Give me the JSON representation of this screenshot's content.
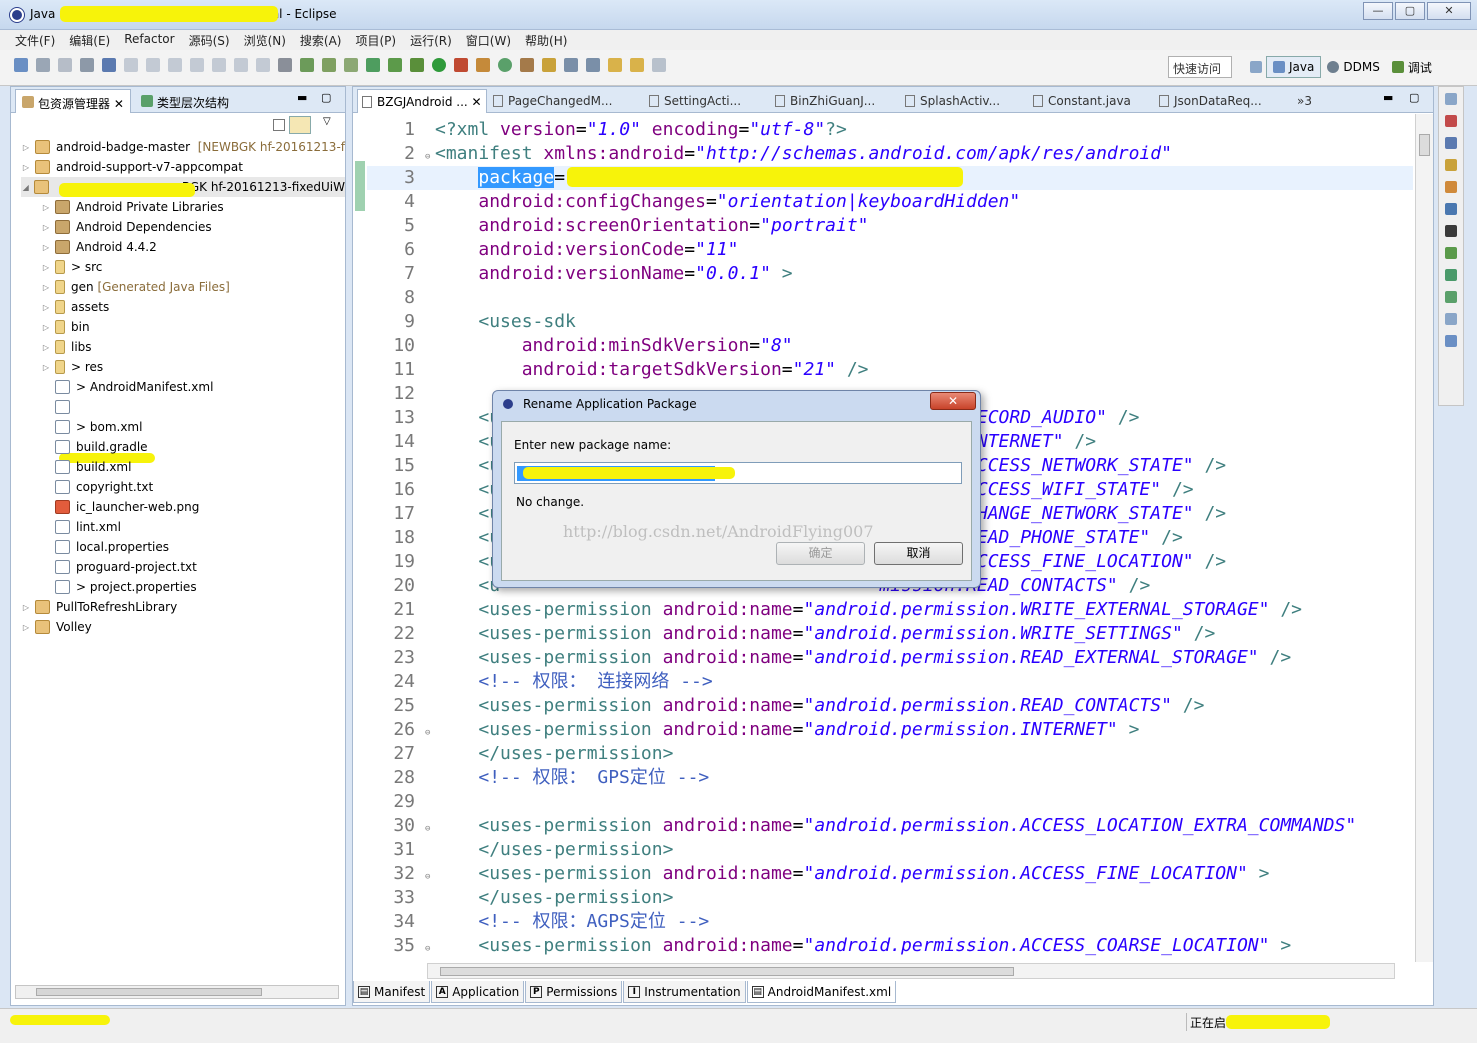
{
  "window": {
    "title": "Java - [ ] Manifest.xml - Eclipse",
    "title_visible_left": "Java",
    "title_visible_right": "Manifest.xml - Eclipse",
    "min": "—",
    "max": "▢",
    "close": "✕"
  },
  "menu": [
    "文件(F)",
    "编辑(E)",
    "Refactor",
    "源码(S)",
    "浏览(N)",
    "搜索(A)",
    "项目(P)",
    "运行(R)",
    "窗口(W)",
    "帮助(H)"
  ],
  "toolbar": {
    "quick_access": "快速访问",
    "perspectives": [
      "Java",
      "DDMS",
      "调试"
    ]
  },
  "left_panel": {
    "tabs": [
      {
        "label": "包资源管理器 ✕"
      },
      {
        "label": "类型层次结构"
      }
    ],
    "tree": [
      {
        "label": "android-badge-master",
        "decoration": "[NEWBGK hf-20161213-f",
        "indent": 0
      },
      {
        "label": "android-support-v7-appcompat",
        "decoration": "",
        "indent": 0
      },
      {
        "label": "BGK hf-20161213-fixedUiW",
        "decoration": "",
        "indent": 0
      },
      {
        "label": "Android Private Libraries",
        "decoration": "",
        "indent": 1
      },
      {
        "label": "Android Dependencies",
        "decoration": "",
        "indent": 1
      },
      {
        "label": "Android 4.4.2",
        "decoration": "",
        "indent": 1
      },
      {
        "label": "> src",
        "decoration": "",
        "indent": 1
      },
      {
        "label": "gen",
        "decoration": "[Generated Java Files]",
        "indent": 1
      },
      {
        "label": "assets",
        "decoration": "",
        "indent": 1
      },
      {
        "label": "bin",
        "decoration": "",
        "indent": 1
      },
      {
        "label": "libs",
        "decoration": "",
        "indent": 1
      },
      {
        "label": "> res",
        "decoration": "",
        "indent": 1
      },
      {
        "label": "> AndroidManifest.xml",
        "decoration": "",
        "indent": 1
      },
      {
        "label": "",
        "decoration": "",
        "indent": 1
      },
      {
        "label": "> bom.xml",
        "decoration": "",
        "indent": 1
      },
      {
        "label": "build.gradle",
        "decoration": "",
        "indent": 1
      },
      {
        "label": "build.xml",
        "decoration": "",
        "indent": 1
      },
      {
        "label": "copyright.txt",
        "decoration": "",
        "indent": 1
      },
      {
        "label": "ic_launcher-web.png",
        "decoration": "",
        "indent": 1
      },
      {
        "label": "lint.xml",
        "decoration": "",
        "indent": 1
      },
      {
        "label": "local.properties",
        "decoration": "",
        "indent": 1
      },
      {
        "label": "proguard-project.txt",
        "decoration": "",
        "indent": 1
      },
      {
        "label": "> project.properties",
        "decoration": "",
        "indent": 1
      },
      {
        "label": "PullToRefreshLibrary",
        "decoration": "",
        "indent": 0
      },
      {
        "label": "Volley",
        "decoration": "",
        "indent": 0
      }
    ]
  },
  "editor": {
    "tabs": [
      "BZGJAndroid ...",
      "PageChangedM...",
      "SettingActi...",
      "BinZhiGuanJ...",
      "SplashActiv...",
      "Constant.java",
      "JsonDataReq...",
      "»3"
    ],
    "lines": [
      {
        "n": "1",
        "fold": "",
        "cur": false,
        "parts": [
          [
            "ct",
            "<?xml "
          ],
          [
            "ca",
            "version"
          ],
          [
            "cn",
            "="
          ],
          [
            "cv",
            "\"1.0\""
          ],
          [
            "ca",
            " encoding"
          ],
          [
            "cn",
            "="
          ],
          [
            "cv",
            "\"utf-8\""
          ],
          [
            "ct",
            "?>"
          ]
        ]
      },
      {
        "n": "2",
        "fold": "⊖",
        "cur": false,
        "parts": [
          [
            "ct",
            "<manifest "
          ],
          [
            "ca",
            "xmlns:android"
          ],
          [
            "cn",
            "="
          ],
          [
            "cv",
            "\"http://schemas.android.com/apk/res/android\""
          ]
        ]
      },
      {
        "n": "3",
        "fold": "",
        "cur": true,
        "parts": [
          [
            "cn",
            "    "
          ],
          [
            "sel",
            "package"
          ],
          [
            "cn",
            "="
          ],
          [
            "cv",
            "\"                              \""
          ]
        ]
      },
      {
        "n": "4",
        "fold": "",
        "cur": false,
        "parts": [
          [
            "cn",
            "    "
          ],
          [
            "ca",
            "android:configChanges"
          ],
          [
            "cn",
            "="
          ],
          [
            "cv",
            "\"orientation|keyboardHidden\""
          ]
        ]
      },
      {
        "n": "5",
        "fold": "",
        "cur": false,
        "parts": [
          [
            "cn",
            "    "
          ],
          [
            "ca",
            "android:screenOrientation"
          ],
          [
            "cn",
            "="
          ],
          [
            "cv",
            "\"portrait\""
          ]
        ]
      },
      {
        "n": "6",
        "fold": "",
        "cur": false,
        "parts": [
          [
            "cn",
            "    "
          ],
          [
            "ca",
            "android:versionCode"
          ],
          [
            "cn",
            "="
          ],
          [
            "cv",
            "\"11\""
          ]
        ]
      },
      {
        "n": "7",
        "fold": "",
        "cur": false,
        "parts": [
          [
            "cn",
            "    "
          ],
          [
            "ca",
            "android:versionName"
          ],
          [
            "cn",
            "="
          ],
          [
            "cv",
            "\"0.0.1\""
          ],
          [
            "ct",
            " >"
          ]
        ]
      },
      {
        "n": "8",
        "fold": "",
        "cur": false,
        "parts": []
      },
      {
        "n": "9",
        "fold": "",
        "cur": false,
        "parts": [
          [
            "cn",
            "    "
          ],
          [
            "ct",
            "<uses-sdk"
          ]
        ]
      },
      {
        "n": "10",
        "fold": "",
        "cur": false,
        "parts": [
          [
            "cn",
            "        "
          ],
          [
            "ca",
            "android:minSdkVersion"
          ],
          [
            "cn",
            "="
          ],
          [
            "cv",
            "\"8\""
          ]
        ]
      },
      {
        "n": "11",
        "fold": "",
        "cur": false,
        "parts": [
          [
            "cn",
            "        "
          ],
          [
            "ca",
            "android:targetSdkVersion"
          ],
          [
            "cn",
            "="
          ],
          [
            "cv",
            "\"21\""
          ],
          [
            "ct",
            " />"
          ]
        ]
      },
      {
        "n": "12",
        "fold": "",
        "cur": false,
        "parts": []
      },
      {
        "n": "13",
        "fold": "",
        "cur": false,
        "parts": [
          [
            "cn",
            "    "
          ],
          [
            "ct",
            "<u"
          ],
          [
            "cn",
            "                                   "
          ],
          [
            "cv",
            "mission.RECORD_AUDIO\""
          ],
          [
            "ct",
            " />"
          ]
        ]
      },
      {
        "n": "14",
        "fold": "",
        "cur": false,
        "parts": [
          [
            "cn",
            "    "
          ],
          [
            "ct",
            "<u"
          ],
          [
            "cn",
            "                                   "
          ],
          [
            "cv",
            "mission.INTERNET\""
          ],
          [
            "ct",
            " />"
          ]
        ]
      },
      {
        "n": "15",
        "fold": "",
        "cur": false,
        "parts": [
          [
            "cn",
            "    "
          ],
          [
            "ct",
            "<u"
          ],
          [
            "cn",
            "                                   "
          ],
          [
            "cv",
            "mission.ACCESS_NETWORK_STATE\""
          ],
          [
            "ct",
            " />"
          ]
        ]
      },
      {
        "n": "16",
        "fold": "",
        "cur": false,
        "parts": [
          [
            "cn",
            "    "
          ],
          [
            "ct",
            "<u"
          ],
          [
            "cn",
            "                                   "
          ],
          [
            "cv",
            "mission.ACCESS_WIFI_STATE\""
          ],
          [
            "ct",
            " />"
          ]
        ]
      },
      {
        "n": "17",
        "fold": "",
        "cur": false,
        "parts": [
          [
            "cn",
            "    "
          ],
          [
            "ct",
            "<u"
          ],
          [
            "cn",
            "                                   "
          ],
          [
            "cv",
            "mission.CHANGE_NETWORK_STATE\""
          ],
          [
            "ct",
            " />"
          ]
        ]
      },
      {
        "n": "18",
        "fold": "",
        "cur": false,
        "parts": [
          [
            "cn",
            "    "
          ],
          [
            "ct",
            "<u"
          ],
          [
            "cn",
            "                                   "
          ],
          [
            "cv",
            "mission.READ_PHONE_STATE\""
          ],
          [
            "ct",
            " />"
          ]
        ]
      },
      {
        "n": "19",
        "fold": "",
        "cur": false,
        "parts": [
          [
            "cn",
            "    "
          ],
          [
            "ct",
            "<u"
          ],
          [
            "cn",
            "                                   "
          ],
          [
            "cv",
            "mission.ACCESS_FINE_LOCATION\""
          ],
          [
            "ct",
            " />"
          ]
        ]
      },
      {
        "n": "20",
        "fold": "",
        "cur": false,
        "parts": [
          [
            "cn",
            "    "
          ],
          [
            "ct",
            "<u"
          ],
          [
            "cn",
            "                                   "
          ],
          [
            "cv",
            "mission.READ_CONTACTS\""
          ],
          [
            "ct",
            " />"
          ]
        ]
      },
      {
        "n": "21",
        "fold": "",
        "cur": false,
        "parts": [
          [
            "cn",
            "    "
          ],
          [
            "ct",
            "<uses-permission "
          ],
          [
            "ca",
            "android:name"
          ],
          [
            "cn",
            "="
          ],
          [
            "cv",
            "\"android.permission.WRITE_EXTERNAL_STORAGE\""
          ],
          [
            "ct",
            " />"
          ]
        ]
      },
      {
        "n": "22",
        "fold": "",
        "cur": false,
        "parts": [
          [
            "cn",
            "    "
          ],
          [
            "ct",
            "<uses-permission "
          ],
          [
            "ca",
            "android:name"
          ],
          [
            "cn",
            "="
          ],
          [
            "cv",
            "\"android.permission.WRITE_SETTINGS\""
          ],
          [
            "ct",
            " />"
          ]
        ]
      },
      {
        "n": "23",
        "fold": "",
        "cur": false,
        "parts": [
          [
            "cn",
            "    "
          ],
          [
            "ct",
            "<uses-permission "
          ],
          [
            "ca",
            "android:name"
          ],
          [
            "cn",
            "="
          ],
          [
            "cv",
            "\"android.permission.READ_EXTERNAL_STORAGE\""
          ],
          [
            "ct",
            " />"
          ]
        ]
      },
      {
        "n": "24",
        "fold": "",
        "cur": false,
        "parts": [
          [
            "cn",
            "    "
          ],
          [
            "cc",
            "<!-- 权限： 连接网络 -->"
          ]
        ]
      },
      {
        "n": "25",
        "fold": "",
        "cur": false,
        "parts": [
          [
            "cn",
            "    "
          ],
          [
            "ct",
            "<uses-permission "
          ],
          [
            "ca",
            "android:name"
          ],
          [
            "cn",
            "="
          ],
          [
            "cv",
            "\"android.permission.READ_CONTACTS\""
          ],
          [
            "ct",
            " />"
          ]
        ]
      },
      {
        "n": "26",
        "fold": "⊖",
        "cur": false,
        "parts": [
          [
            "cn",
            "    "
          ],
          [
            "ct",
            "<uses-permission "
          ],
          [
            "ca",
            "android:name"
          ],
          [
            "cn",
            "="
          ],
          [
            "cv",
            "\"android.permission.INTERNET\""
          ],
          [
            "ct",
            " >"
          ]
        ]
      },
      {
        "n": "27",
        "fold": "",
        "cur": false,
        "parts": [
          [
            "cn",
            "    "
          ],
          [
            "ct",
            "</uses-permission>"
          ]
        ]
      },
      {
        "n": "28",
        "fold": "",
        "cur": false,
        "parts": [
          [
            "cn",
            "    "
          ],
          [
            "cc",
            "<!-- 权限： GPS定位 -->"
          ]
        ]
      },
      {
        "n": "29",
        "fold": "",
        "cur": false,
        "parts": []
      },
      {
        "n": "30",
        "fold": "⊖",
        "cur": false,
        "parts": [
          [
            "cn",
            "    "
          ],
          [
            "ct",
            "<uses-permission "
          ],
          [
            "ca",
            "android:name"
          ],
          [
            "cn",
            "="
          ],
          [
            "cv",
            "\"android.permission.ACCESS_LOCATION_EXTRA_COMMANDS\""
          ]
        ]
      },
      {
        "n": "31",
        "fold": "",
        "cur": false,
        "parts": [
          [
            "cn",
            "    "
          ],
          [
            "ct",
            "</uses-permission>"
          ]
        ]
      },
      {
        "n": "32",
        "fold": "⊖",
        "cur": false,
        "parts": [
          [
            "cn",
            "    "
          ],
          [
            "ct",
            "<uses-permission "
          ],
          [
            "ca",
            "android:name"
          ],
          [
            "cn",
            "="
          ],
          [
            "cv",
            "\"android.permission.ACCESS_FINE_LOCATION\""
          ],
          [
            "ct",
            " >"
          ]
        ]
      },
      {
        "n": "33",
        "fold": "",
        "cur": false,
        "parts": [
          [
            "cn",
            "    "
          ],
          [
            "ct",
            "</uses-permission>"
          ]
        ]
      },
      {
        "n": "34",
        "fold": "",
        "cur": false,
        "parts": [
          [
            "cn",
            "    "
          ],
          [
            "cc",
            "<!-- 权限：AGPS定位 -->"
          ]
        ]
      },
      {
        "n": "35",
        "fold": "⊖",
        "cur": false,
        "parts": [
          [
            "cn",
            "    "
          ],
          [
            "ct",
            "<uses-permission "
          ],
          [
            "ca",
            "android:name"
          ],
          [
            "cn",
            "="
          ],
          [
            "cv",
            "\"android.permission.ACCESS_COARSE_LOCATION\""
          ],
          [
            "ct",
            " >"
          ]
        ]
      }
    ],
    "bottom_tabs": [
      {
        "icon": "▤",
        "label": "Manifest"
      },
      {
        "icon": "A",
        "label": "Application"
      },
      {
        "icon": "P",
        "label": "Permissions"
      },
      {
        "icon": "I",
        "label": "Instrumentation"
      },
      {
        "icon": "▤",
        "label": "AndroidManifest.xml"
      }
    ]
  },
  "dialog": {
    "title": "Rename Application Package",
    "close": "✕",
    "label": "Enter new package name:",
    "value": "",
    "message": "No change.",
    "ok": "确定",
    "cancel": "取消"
  },
  "watermark": "http://blog.csdn.net/AndroidFlying007",
  "status": {
    "left": "",
    "right": "正在启"
  }
}
